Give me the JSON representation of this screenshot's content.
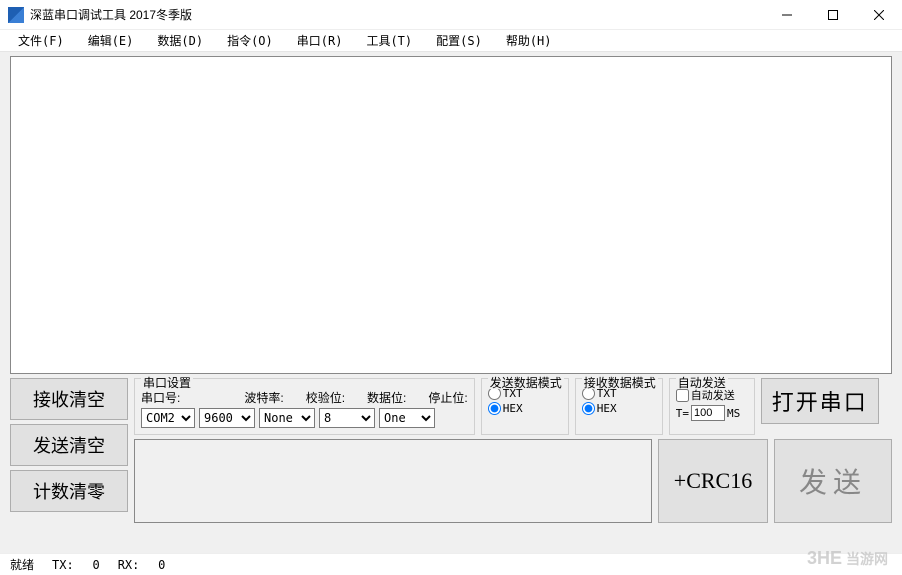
{
  "window": {
    "title": "深蓝串口调试工具 2017冬季版"
  },
  "menu": {
    "file": "文件(F)",
    "edit": "编辑(E)",
    "data": "数据(D)",
    "instr": "指令(O)",
    "serial": "串口(R)",
    "tools": "工具(T)",
    "config": "配置(S)",
    "help": "帮助(H)"
  },
  "buttons": {
    "clear_rx": "接收清空",
    "clear_tx": "发送清空",
    "reset_count": "计数清零",
    "open_port": "打开串口",
    "crc": "+CRC16",
    "send": "发送"
  },
  "serial_settings": {
    "legend": "串口设置",
    "port_label": "串口号:",
    "port_value": "COM2",
    "baud_label": "波特率:",
    "baud_value": "9600",
    "parity_label": "校验位:",
    "parity_value": "None",
    "databits_label": "数据位:",
    "databits_value": "8",
    "stopbits_label": "停止位:",
    "stopbits_value": "One"
  },
  "tx_mode": {
    "legend": "发送数据模式",
    "txt": "TXT",
    "hex": "HEX",
    "selected": "HEX"
  },
  "rx_mode": {
    "legend": "接收数据模式",
    "txt": "TXT",
    "hex": "HEX",
    "selected": "HEX"
  },
  "auto_send": {
    "legend": "自动发送",
    "checkbox_label": "自动发送",
    "t_prefix": "T=",
    "t_value": "100",
    "t_unit": "MS"
  },
  "status": {
    "ready": "就绪",
    "tx_label": "TX:",
    "tx_value": "0",
    "rx_label": "RX:",
    "rx_value": "0"
  },
  "watermark": {
    "logo": "3HE",
    "text": "当游网"
  }
}
